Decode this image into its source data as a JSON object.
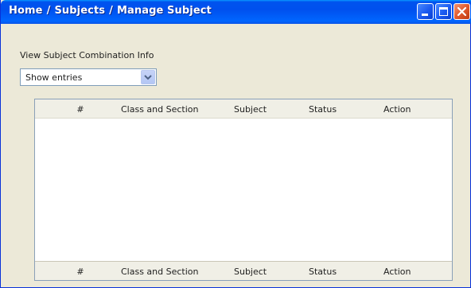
{
  "window": {
    "breadcrumb": [
      "Home",
      "Subjects",
      "Manage Subject"
    ],
    "separator": "/",
    "buttons": [
      "minimize",
      "maximize",
      "close"
    ]
  },
  "section": {
    "title": "View Subject Combination Info"
  },
  "entries_select": {
    "value": "Show entries"
  },
  "table": {
    "columns": [
      "#",
      "Class and Section",
      "Subject",
      "Status",
      "Action"
    ],
    "rows": []
  },
  "icons": {
    "dropdown": "chevron-down-icon",
    "minimize": "minimize-icon",
    "maximize": "maximize-icon",
    "close": "close-icon"
  },
  "colors": {
    "titlebar": "#0053ee",
    "window_bg": "#ece9d8",
    "close_button": "#e05a2d",
    "table_header_bg": "#f0efe6",
    "table_border": "#8aa0b8"
  }
}
